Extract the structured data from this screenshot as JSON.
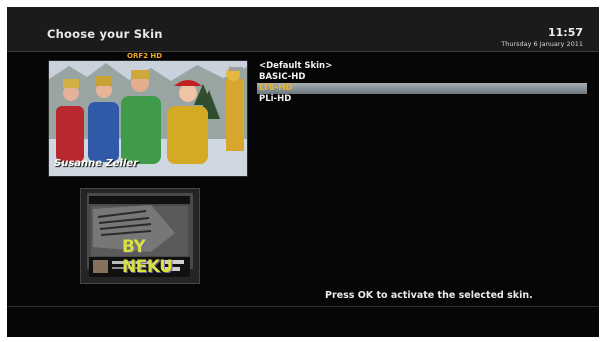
{
  "header": {
    "title": "Choose your Skin",
    "time": "11:57",
    "date": "Thursday 6 January 2011"
  },
  "preview": {
    "channel": "ORF2 HD",
    "caption": "Susanne Zeiler"
  },
  "thumbnail": {
    "text": "BY NEKU"
  },
  "skins": [
    "<Default Skin>",
    "BASIC-HD",
    "LT6-HD",
    "PLi-HD"
  ],
  "selected_skin": "LT6-HD",
  "hint": "Press OK to activate the selected skin.",
  "colors": {
    "background": "#060606",
    "header": "#1b1b1b",
    "channel": "#f2a81d",
    "selected_text": "#e7b42a"
  }
}
